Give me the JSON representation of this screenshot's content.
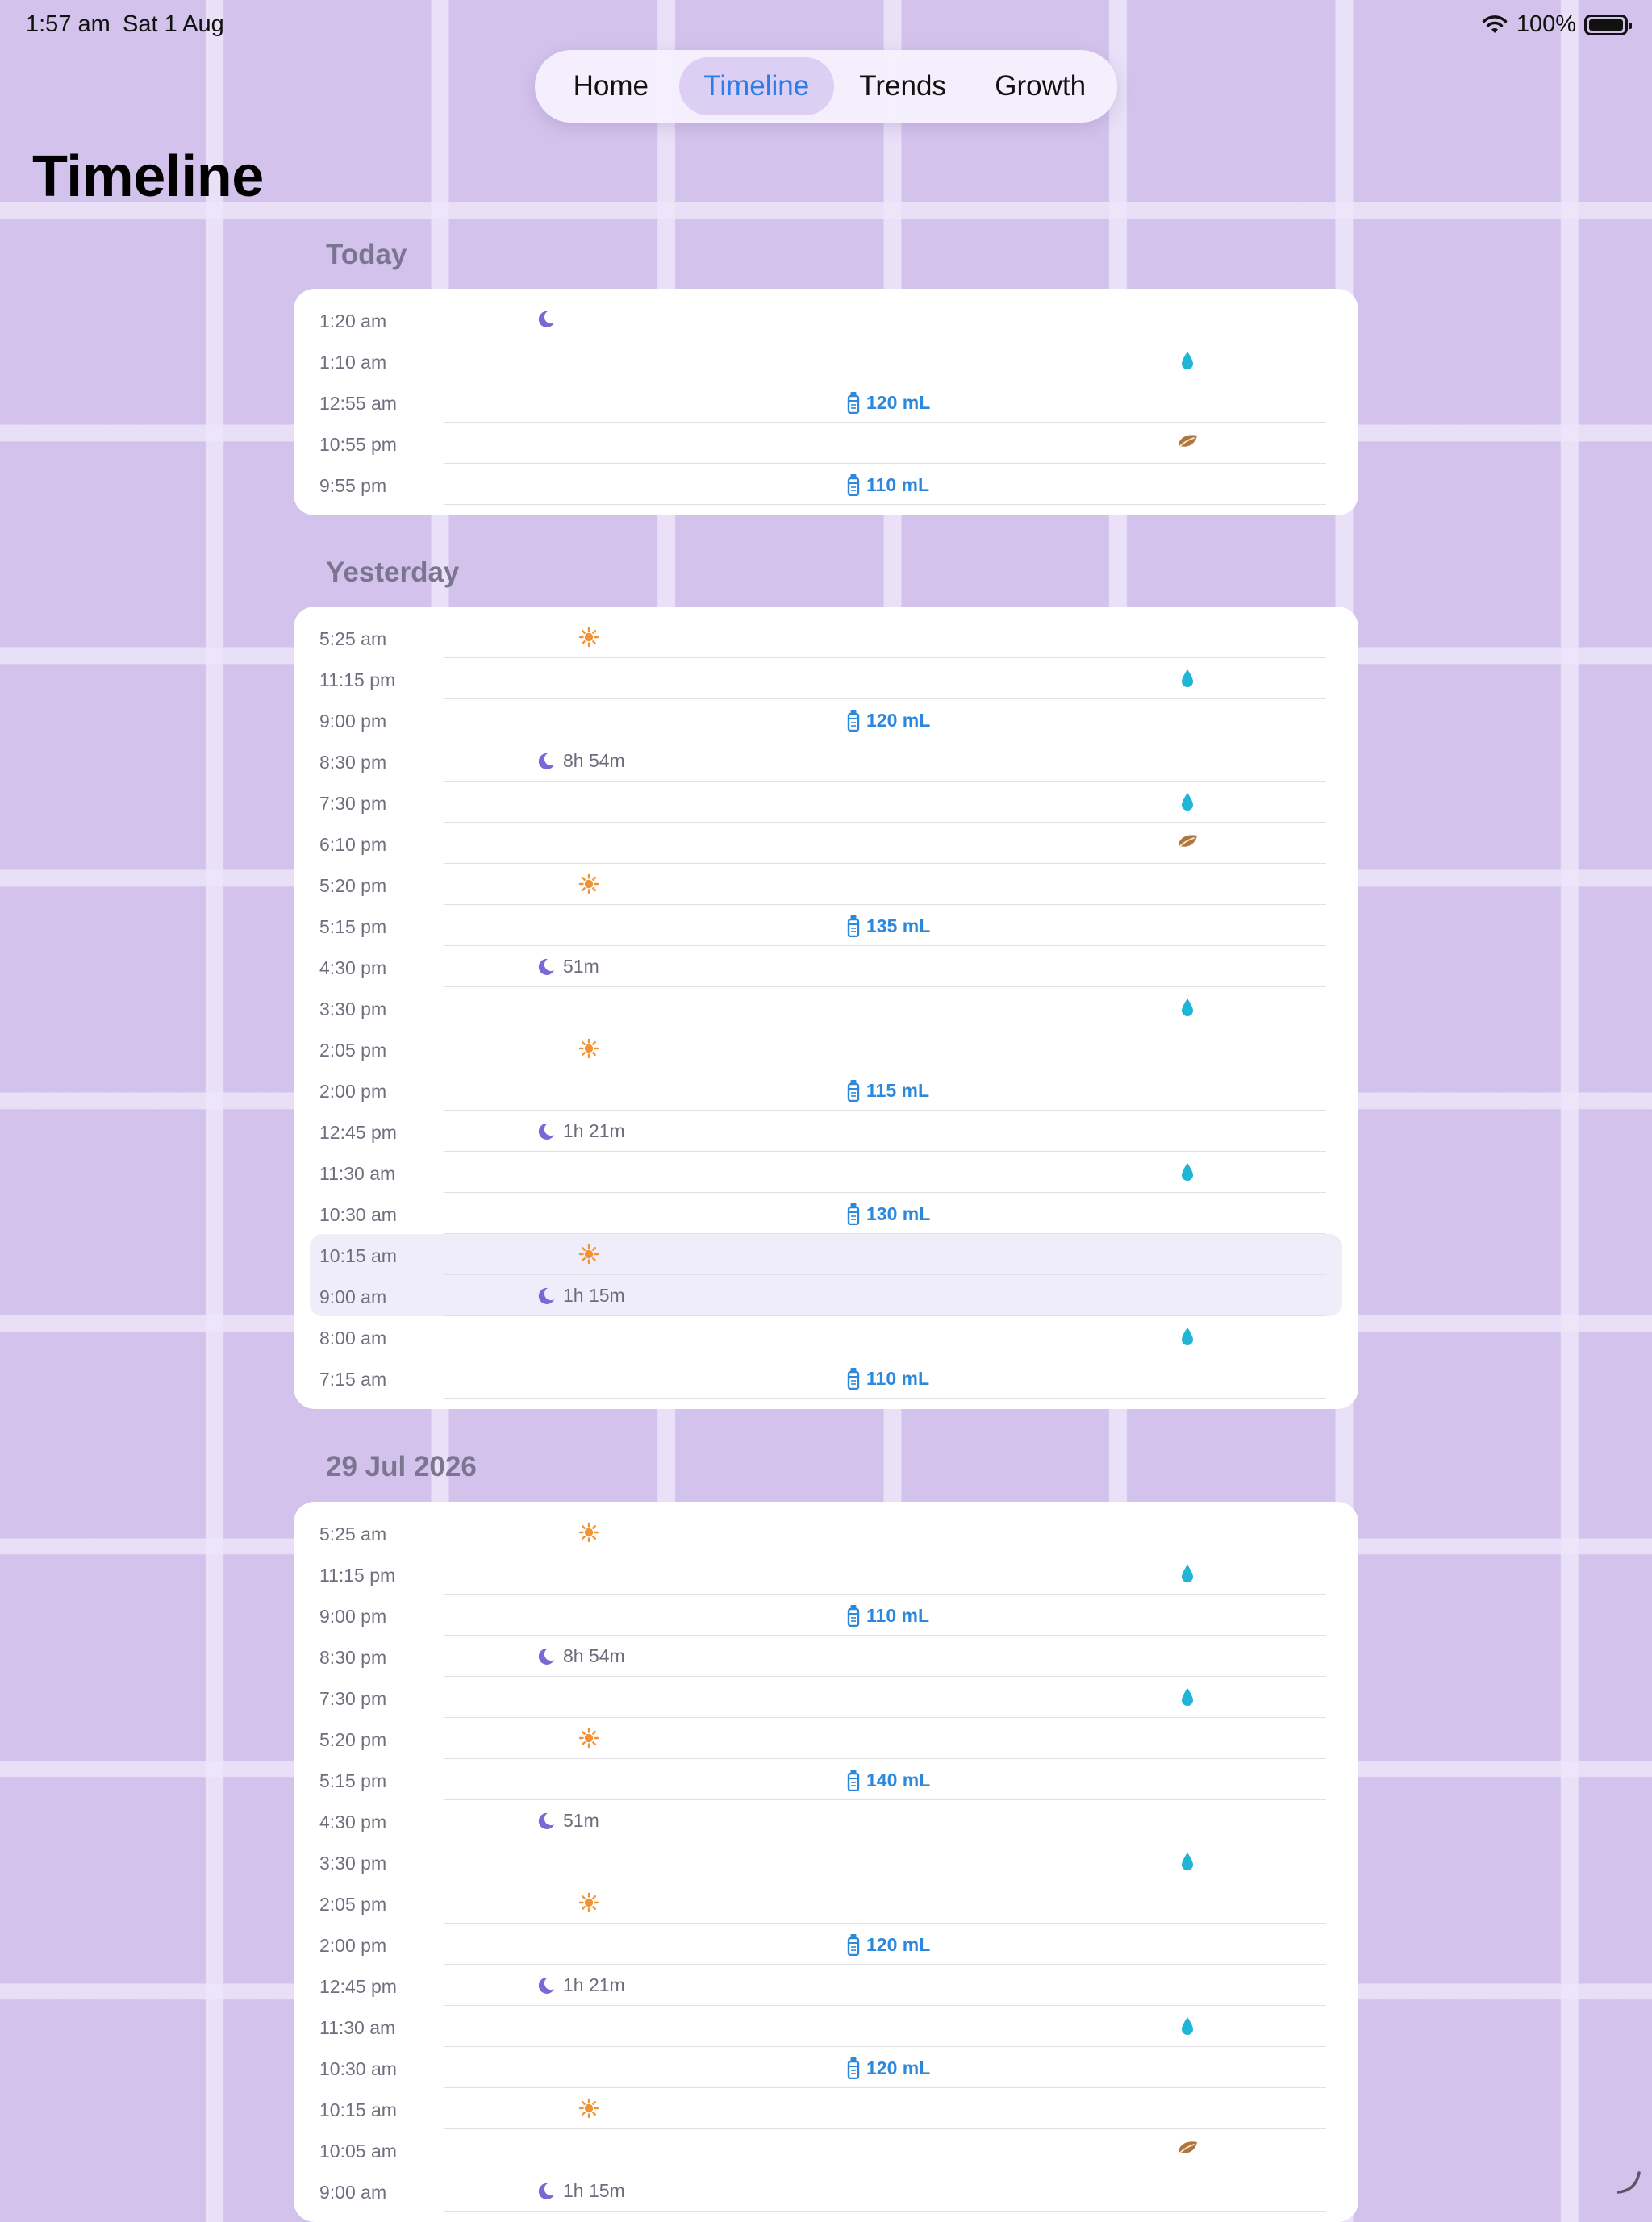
{
  "status_bar": {
    "time": "1:57 am",
    "date": "Sat 1 Aug",
    "battery": "100%"
  },
  "tabs": [
    {
      "label": "Home",
      "active": false
    },
    {
      "label": "Timeline",
      "active": true
    },
    {
      "label": "Trends",
      "active": false
    },
    {
      "label": "Growth",
      "active": false
    }
  ],
  "page_title": "Timeline",
  "colors": {
    "accent": "#2a7ee6",
    "sleep": "#7a68d6",
    "wake": "#f39234",
    "bottle": "#2b88dc",
    "wet": "#1fb5d6",
    "dirty": "#b0763c"
  },
  "sections": [
    {
      "title": "Today",
      "events": [
        {
          "time": "1:20 am",
          "type": "sleep",
          "label": ""
        },
        {
          "time": "1:10 am",
          "type": "wet",
          "label": ""
        },
        {
          "time": "12:55 am",
          "type": "bottle",
          "label": "120 mL"
        },
        {
          "time": "10:55 pm",
          "type": "dirty",
          "label": ""
        },
        {
          "time": "9:55 pm",
          "type": "bottle",
          "label": "110 mL"
        }
      ]
    },
    {
      "title": "Yesterday",
      "events": [
        {
          "time": "5:25 am",
          "type": "wake",
          "label": ""
        },
        {
          "time": "11:15 pm",
          "type": "wet",
          "label": ""
        },
        {
          "time": "9:00 pm",
          "type": "bottle",
          "label": "120 mL"
        },
        {
          "time": "8:30 pm",
          "type": "sleep",
          "label": "8h 54m"
        },
        {
          "time": "7:30 pm",
          "type": "wet",
          "label": ""
        },
        {
          "time": "6:10 pm",
          "type": "dirty",
          "label": ""
        },
        {
          "time": "5:20 pm",
          "type": "wake",
          "label": ""
        },
        {
          "time": "5:15 pm",
          "type": "bottle",
          "label": "135 mL"
        },
        {
          "time": "4:30 pm",
          "type": "sleep",
          "label": "51m"
        },
        {
          "time": "3:30 pm",
          "type": "wet",
          "label": ""
        },
        {
          "time": "2:05 pm",
          "type": "wake",
          "label": ""
        },
        {
          "time": "2:00 pm",
          "type": "bottle",
          "label": "115 mL"
        },
        {
          "time": "12:45 pm",
          "type": "sleep",
          "label": "1h 21m"
        },
        {
          "time": "11:30 am",
          "type": "wet",
          "label": ""
        },
        {
          "time": "10:30 am",
          "type": "bottle",
          "label": "130 mL"
        },
        {
          "time": "10:15 am",
          "type": "wake",
          "label": "",
          "highlight": true
        },
        {
          "time": "9:00 am",
          "type": "sleep",
          "label": "1h 15m",
          "highlight": true
        },
        {
          "time": "8:00 am",
          "type": "wet",
          "label": ""
        },
        {
          "time": "7:15 am",
          "type": "bottle",
          "label": "110 mL"
        }
      ]
    },
    {
      "title": "29 Jul 2026",
      "events": [
        {
          "time": "5:25 am",
          "type": "wake",
          "label": ""
        },
        {
          "time": "11:15 pm",
          "type": "wet",
          "label": ""
        },
        {
          "time": "9:00 pm",
          "type": "bottle",
          "label": "110 mL"
        },
        {
          "time": "8:30 pm",
          "type": "sleep",
          "label": "8h 54m"
        },
        {
          "time": "7:30 pm",
          "type": "wet",
          "label": ""
        },
        {
          "time": "5:20 pm",
          "type": "wake",
          "label": ""
        },
        {
          "time": "5:15 pm",
          "type": "bottle",
          "label": "140 mL"
        },
        {
          "time": "4:30 pm",
          "type": "sleep",
          "label": "51m"
        },
        {
          "time": "3:30 pm",
          "type": "wet",
          "label": ""
        },
        {
          "time": "2:05 pm",
          "type": "wake",
          "label": ""
        },
        {
          "time": "2:00 pm",
          "type": "bottle",
          "label": "120 mL"
        },
        {
          "time": "12:45 pm",
          "type": "sleep",
          "label": "1h 21m"
        },
        {
          "time": "11:30 am",
          "type": "wet",
          "label": ""
        },
        {
          "time": "10:30 am",
          "type": "bottle",
          "label": "120 mL"
        },
        {
          "time": "10:15 am",
          "type": "wake",
          "label": ""
        },
        {
          "time": "10:05 am",
          "type": "dirty",
          "label": ""
        },
        {
          "time": "9:00 am",
          "type": "sleep",
          "label": "1h 15m"
        }
      ]
    }
  ]
}
